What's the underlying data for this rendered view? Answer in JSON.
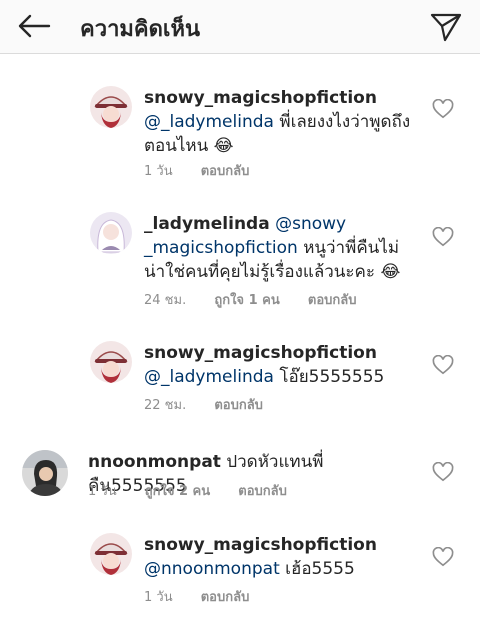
{
  "header": {
    "title": "ความคิดเห็น"
  },
  "comments": [
    {
      "username": "snowy_magicshopfiction",
      "mention": "@_ladymelinda",
      "text_line1": "พี่เลยงงไงว่าพูดถึง",
      "text_line2": "ตอนไหน 😂",
      "time": "1 วัน",
      "reply_label": "ตอบกลับ"
    },
    {
      "username": "_ladymelinda",
      "mention_line1": "@snowy",
      "mention_line2": "_magicshopfiction",
      "text_line2": "หนูว่าพี่คืนไม่",
      "text_line3": "น่าใช่คนที่คุยไม่รู้เรื่องแล้วนะคะ 😂",
      "time": "24 ชม.",
      "likes_label": "ถูกใจ 1 คน",
      "reply_label": "ตอบกลับ"
    },
    {
      "username": "snowy_magicshopfiction",
      "mention": "@_ladymelinda",
      "text": "โอ๊ย5555555",
      "time": "22 ชม.",
      "reply_label": "ตอบกลับ"
    },
    {
      "username": "nnoonmonpat",
      "text": "ปวดหัวแทนพี่คืน5555555",
      "time": "1 วัน",
      "likes_label": "ถูกใจ 2 คน",
      "reply_label": "ตอบกลับ"
    },
    {
      "username": "snowy_magicshopfiction",
      "mention": "@nnoonmonpat",
      "text": "เฮ้อ5555",
      "time": "1 วัน",
      "reply_label": "ตอบกลับ"
    }
  ]
}
